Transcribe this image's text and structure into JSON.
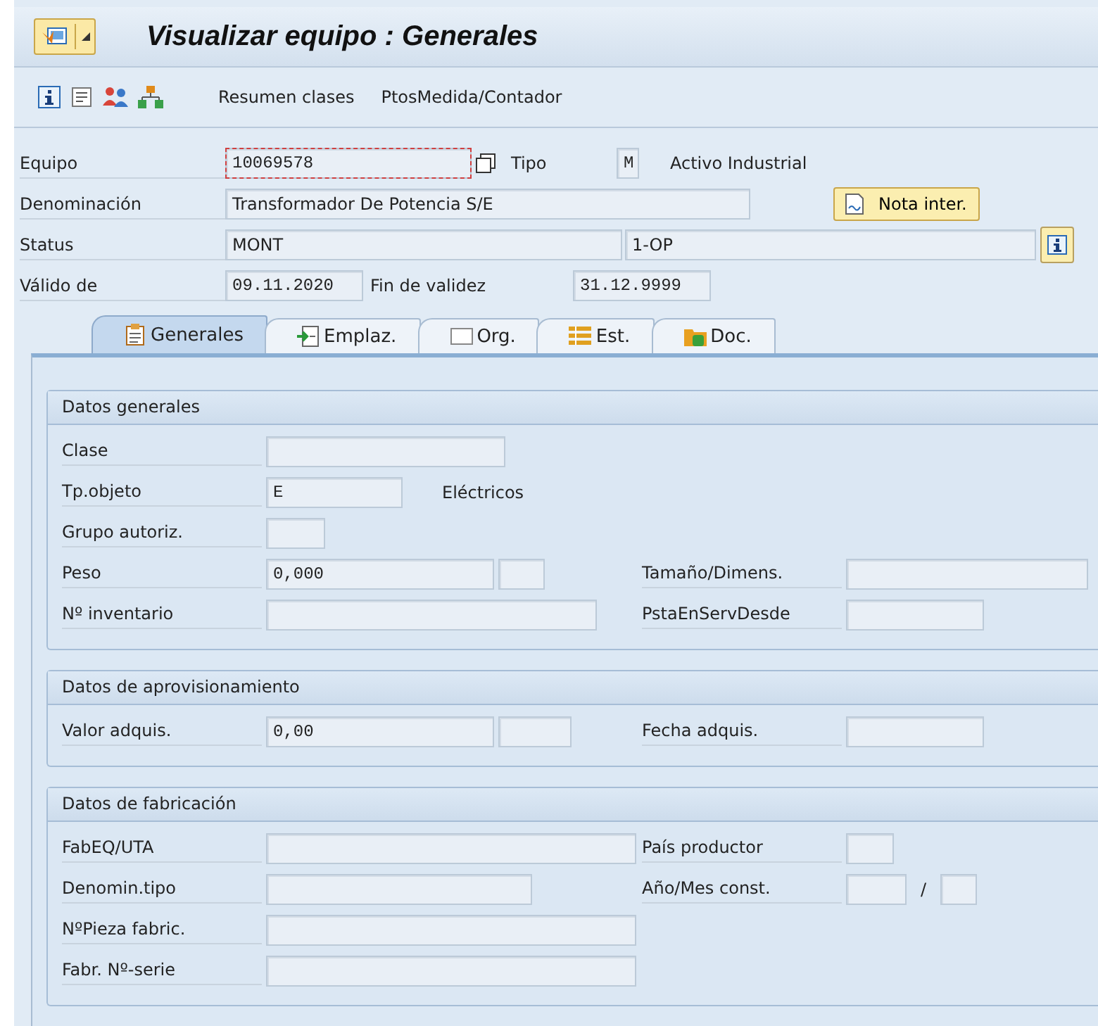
{
  "window": {
    "title": "Visualizar equipo : Generales"
  },
  "toolbar": {
    "buttons": [
      {
        "label": "Resumen clases"
      },
      {
        "label": "PtosMedida/Contador"
      }
    ]
  },
  "header": {
    "equipo": {
      "label": "Equipo",
      "value": "10069578",
      "focused": true
    },
    "tipo": {
      "label": "Tipo",
      "value": "M",
      "description": "Activo Industrial"
    },
    "denominacion": {
      "label": "Denominación",
      "value": "Transformador De Potencia  S/E"
    },
    "nota_button": {
      "label": "Nota inter."
    },
    "status": {
      "label": "Status",
      "value": "MONT",
      "value_2": "1-OP"
    },
    "valido_de": {
      "label": "Válido de",
      "value": "09.11.2020"
    },
    "fin_validez": {
      "label": "Fin de validez",
      "value": "31.12.9999"
    }
  },
  "tabs": [
    {
      "label": "Generales",
      "selected": true
    },
    {
      "label": "Emplaz.",
      "selected": false
    },
    {
      "label": "Org.",
      "selected": false
    },
    {
      "label": "Est.",
      "selected": false
    },
    {
      "label": "Doc.",
      "selected": false
    }
  ],
  "sections": [
    {
      "title": "Datos generales",
      "rows": [
        {
          "label": "Clase",
          "fields": [
            {
              "kind": "field"
            }
          ]
        },
        {
          "label": "Tp.objeto",
          "fields": [
            {
              "kind": "field",
              "value": "E"
            }
          ],
          "description": "Eléctricos"
        },
        {
          "label": "Grupo autoriz.",
          "fields": [
            {
              "kind": "field"
            }
          ]
        },
        {
          "label": "Peso",
          "fields": [
            {
              "kind": "field",
              "value": "0,000"
            },
            {
              "kind": "field"
            }
          ],
          "right": {
            "label": "Tamaño/Dimens.",
            "fields": [
              {
                "kind": "field"
              }
            ]
          }
        },
        {
          "label": "Nº inventario",
          "fields": [
            {
              "kind": "field"
            }
          ],
          "right": {
            "label": "PstaEnServDesde",
            "fields": [
              {
                "kind": "field"
              }
            ]
          }
        }
      ]
    },
    {
      "title": "Datos de aprovisionamiento",
      "rows": [
        {
          "label": "Valor adquis.",
          "fields": [
            {
              "kind": "field",
              "value": "0,00"
            },
            {
              "kind": "field"
            }
          ],
          "right": {
            "label": "Fecha adquis.",
            "fields": [
              {
                "kind": "field"
              }
            ]
          }
        }
      ]
    },
    {
      "title": "Datos de fabricación",
      "rows": [
        {
          "label": "FabEQ/UTA",
          "fields": [
            {
              "kind": "field"
            }
          ],
          "right": {
            "label": "País productor",
            "fields": [
              {
                "kind": "field"
              }
            ]
          }
        },
        {
          "label": "Denomin.tipo",
          "fields": [
            {
              "kind": "field"
            }
          ],
          "right": {
            "label": "Año/Mes const.",
            "fields": [
              {
                "kind": "field"
              },
              {
                "kind": "text",
                "text": "/"
              },
              {
                "kind": "field"
              }
            ]
          }
        },
        {
          "label": "NºPieza fabric.",
          "fields": [
            {
              "kind": "field"
            }
          ]
        },
        {
          "label": "Fabr. Nº-serie",
          "fields": [
            {
              "kind": "field"
            }
          ]
        }
      ]
    }
  ]
}
